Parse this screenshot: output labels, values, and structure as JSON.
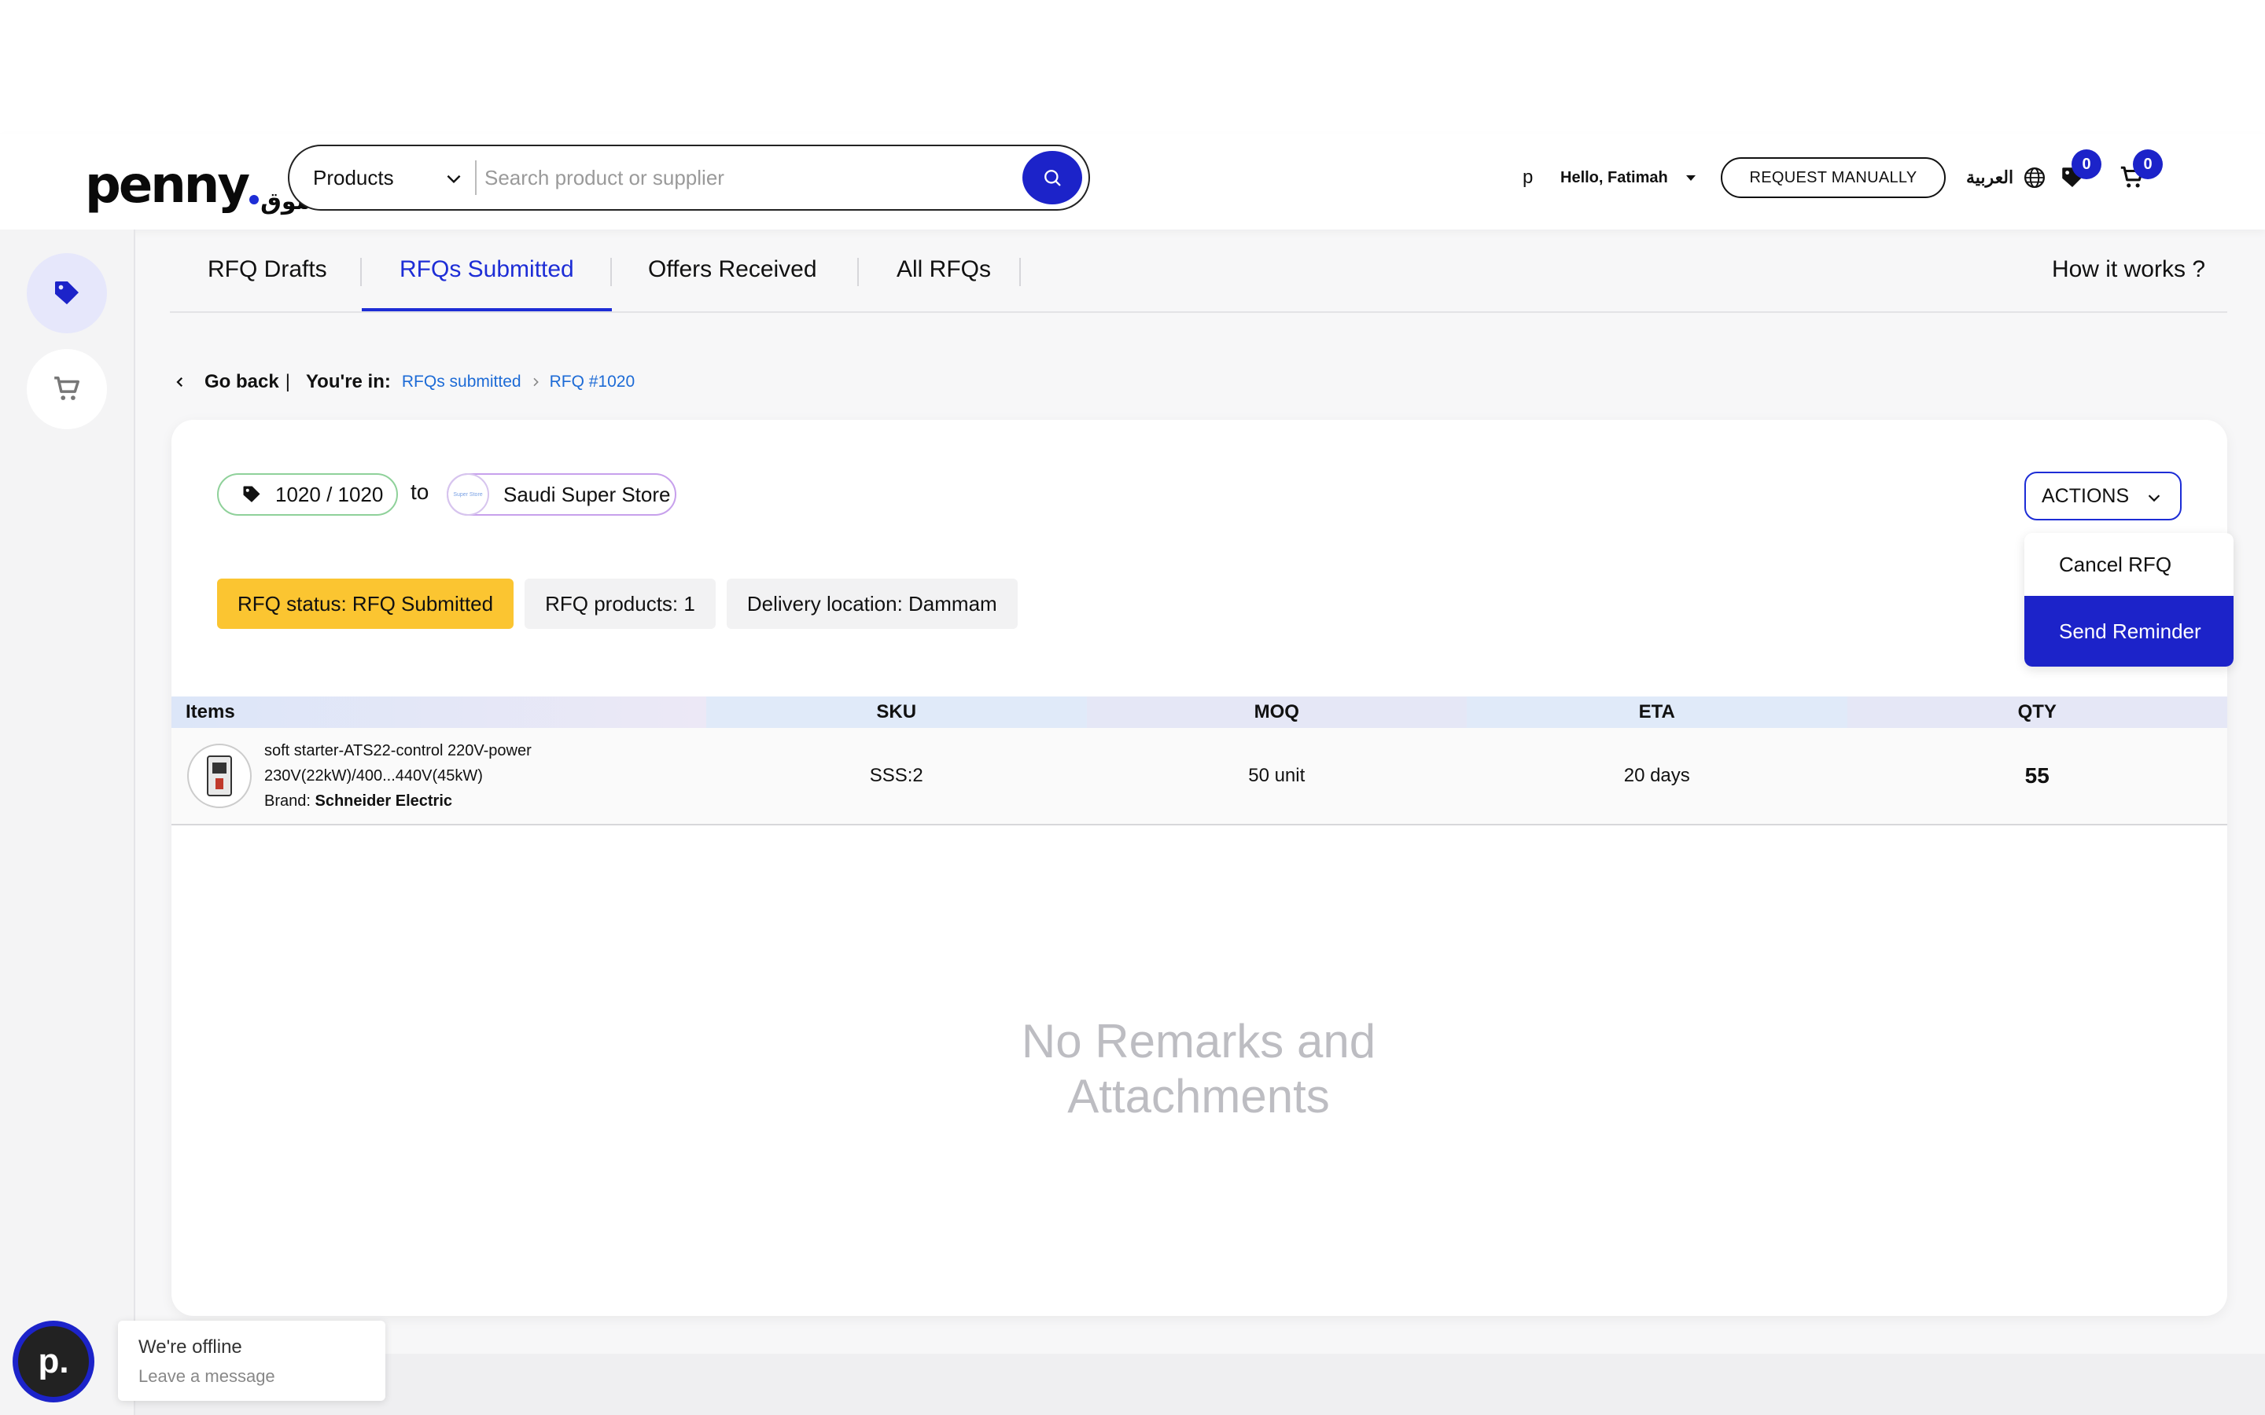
{
  "header": {
    "logo_text": "penny",
    "logo_arabic": "سوق",
    "search": {
      "category": "Products",
      "placeholder": "Search product or supplier"
    },
    "user_initial": "p",
    "greeting": "Hello, Fatimah",
    "request_manually": "REQUEST MANUALLY",
    "language": "العربية",
    "wishlist_count": "0",
    "cart_count": "0"
  },
  "tabs": [
    {
      "label": "RFQ Drafts"
    },
    {
      "label": "RFQs Submitted",
      "active": true
    },
    {
      "label": "Offers Received"
    },
    {
      "label": "All RFQs"
    }
  ],
  "how_it_works": "How it works ?",
  "breadcrumb": {
    "back": "Go back",
    "separator": "|",
    "youre_in": "You're in:",
    "level1": "RFQs submitted",
    "level2": "RFQ #1020"
  },
  "rfq": {
    "id": "1020 / 1020",
    "to": "to",
    "supplier": "Saudi Super Store",
    "supplier_logo_text": "Super Store",
    "status": "RFQ status: RFQ Submitted",
    "products": "RFQ products: 1",
    "delivery": "Delivery location: Dammam"
  },
  "actions": {
    "label": "ACTIONS",
    "items": [
      "Cancel RFQ",
      "Send Reminder"
    ]
  },
  "table": {
    "headers": [
      "Items",
      "SKU",
      "MOQ",
      "ETA",
      "QTY"
    ],
    "rows": [
      {
        "name_line1": "soft starter-ATS22-control 220V-power",
        "name_line2": "230V(22kW)/400...440V(45kW)",
        "brand_label": "Brand:",
        "brand": "Schneider Electric",
        "sku": "SSS:2",
        "moq": "50 unit",
        "eta": "20 days",
        "qty": "55"
      }
    ]
  },
  "empty_state": {
    "line1": "No Remarks and",
    "line2": "Attachments"
  },
  "chat": {
    "avatar": "p.",
    "title": "We're offline",
    "subtitle": "Leave a message"
  },
  "colors": {
    "primary": "#1c23c9",
    "status_yellow": "#fbc531",
    "link": "#1d6bd6"
  }
}
